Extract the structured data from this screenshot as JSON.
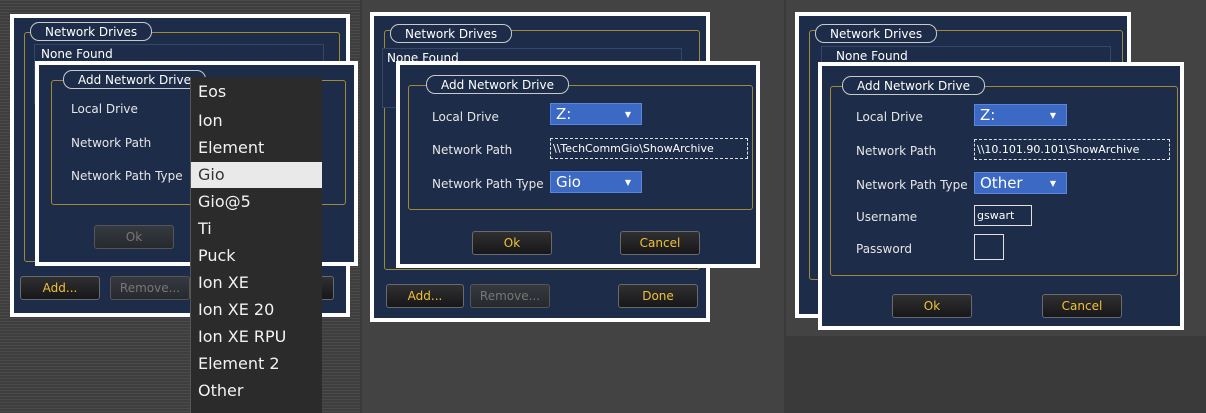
{
  "panel1": {
    "network_drives_tab": "Network Drives",
    "none_found": "None Found",
    "add_drive_tab": "Add Network Drive",
    "local_drive_label": "Local Drive",
    "network_path_label": "Network Path",
    "network_path_type_label": "Network Path Type",
    "ok_label": "Ok",
    "add_label": "Add...",
    "remove_label": "Remove...",
    "menu_items": [
      "Eos",
      "Ion",
      "Element",
      "Gio",
      "Gio@5",
      "Ti",
      "Puck",
      "Ion XE",
      "Ion XE 20",
      "Ion XE RPU",
      "Element 2",
      "Other"
    ],
    "selected_item": "Gio"
  },
  "panel2": {
    "network_drives_tab": "Network Drives",
    "none_found": "None Found",
    "add_drive_tab": "Add Network Drive",
    "local_drive_label": "Local Drive",
    "local_drive_value": "Z:",
    "network_path_label": "Network Path",
    "network_path_value": "\\\\TechCommGio\\ShowArchive",
    "network_path_type_label": "Network Path Type",
    "network_path_type_value": "Gio",
    "ok_label": "Ok",
    "cancel_label": "Cancel",
    "add_label": "Add...",
    "remove_label": "Remove...",
    "done_label": "Done"
  },
  "panel3": {
    "network_drives_tab": "Network Drives",
    "none_found": "None Found",
    "add_drive_tab": "Add Network Drive",
    "local_drive_label": "Local Drive",
    "local_drive_value": "Z:",
    "network_path_label": "Network Path",
    "network_path_value": "\\\\10.101.90.101\\ShowArchive",
    "network_path_type_label": "Network Path Type",
    "network_path_type_value": "Other",
    "username_label": "Username",
    "username_value": "gswart",
    "password_label": "Password",
    "password_value": "",
    "ok_label": "Ok",
    "cancel_label": "Cancel"
  },
  "icons": {
    "dropdown_arrow": "caret-down-icon"
  },
  "colors": {
    "window_bg": "#1d2c48",
    "accent_text": "#f1c232",
    "dropdown_bg": "#3b69c4",
    "border": "#ffffff"
  }
}
